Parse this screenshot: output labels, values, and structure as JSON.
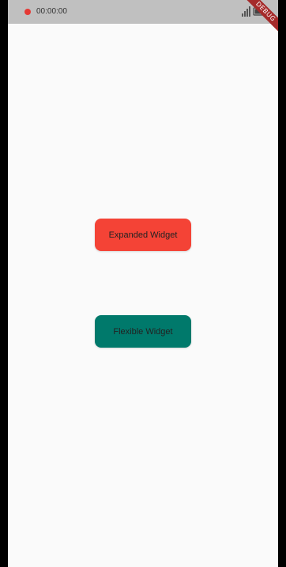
{
  "status_bar": {
    "recording_time": "00:00:00",
    "debug_banner": "DEBUG"
  },
  "widgets": {
    "expanded": {
      "label": "Expanded Widget",
      "color": "#f44336"
    },
    "flexible": {
      "label": "Flexible Widget",
      "color": "#00796b"
    }
  },
  "icons": [
    "record-dot-icon",
    "signal-icon",
    "battery-icon"
  ],
  "colors": {
    "background": "#fafafa",
    "status_bar": "#c0c0c0",
    "banner": "#a52a2a"
  }
}
